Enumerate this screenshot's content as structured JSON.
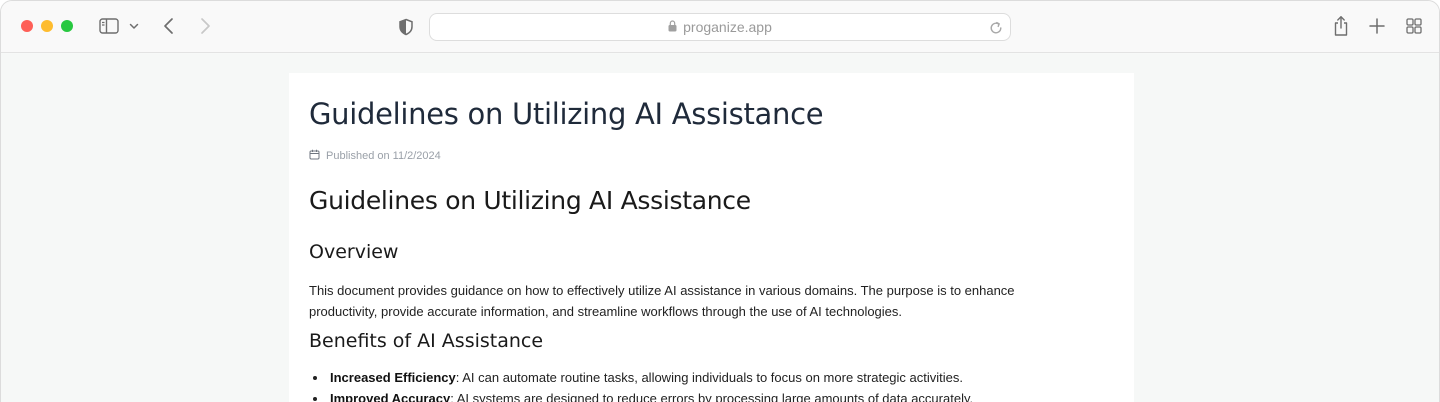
{
  "browser": {
    "url": "proganize.app",
    "icons": [
      "sidebar-icon",
      "chevron-down-icon",
      "back-icon",
      "forward-icon",
      "shield-icon",
      "lock-icon",
      "reload-icon",
      "share-icon",
      "plus-icon",
      "tab-overview-icon"
    ]
  },
  "article": {
    "title": "Guidelines on Utilizing AI Assistance",
    "published": "Published on 11/2/2024",
    "heading": "Guidelines on Utilizing AI Assistance",
    "overview_heading": "Overview",
    "overview_text": "This document provides guidance on how to effectively utilize AI assistance in various domains. The purpose is to enhance productivity, provide accurate information, and streamline workflows through the use of AI technologies.",
    "benefits_heading": "Benefits of AI Assistance",
    "benefits": [
      {
        "term": "Increased Efficiency",
        "text": ": AI can automate routine tasks, allowing individuals to focus on more strategic activities."
      },
      {
        "term": "Improved Accuracy",
        "text": ": AI systems are designed to reduce errors by processing large amounts of data accurately."
      }
    ]
  }
}
